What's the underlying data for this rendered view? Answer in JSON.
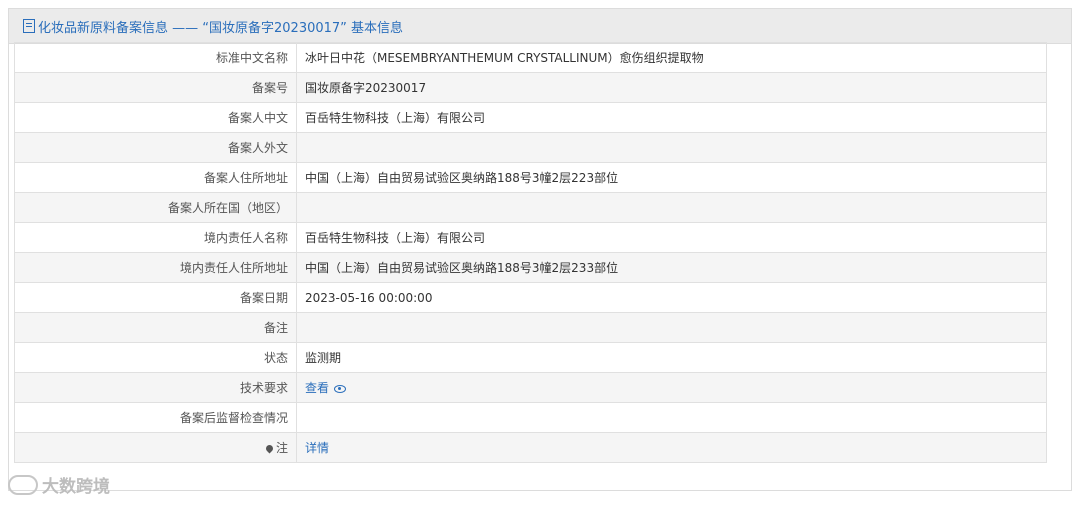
{
  "header": {
    "title": "化妆品新原料备案信息 —— “国妆原备字20230017” 基本信息"
  },
  "rows": [
    {
      "label": "标准中文名称",
      "value": "冰叶日中花（MESEMBRYANTHEMUM CRYSTALLINUM）愈伤组织提取物"
    },
    {
      "label": "备案号",
      "value": "国妆原备字20230017"
    },
    {
      "label": "备案人中文",
      "value": "百岳特生物科技（上海）有限公司"
    },
    {
      "label": "备案人外文",
      "value": ""
    },
    {
      "label": "备案人住所地址",
      "value": "中国（上海）自由贸易试验区奥纳路188号3幢2层223部位"
    },
    {
      "label": "备案人所在国（地区）",
      "value": ""
    },
    {
      "label": "境内责任人名称",
      "value": "百岳特生物科技（上海）有限公司"
    },
    {
      "label": "境内责任人住所地址",
      "value": "中国（上海）自由贸易试验区奥纳路188号3幢2层233部位"
    },
    {
      "label": "备案日期",
      "value": "2023-05-16 00:00:00"
    },
    {
      "label": "备注",
      "value": ""
    },
    {
      "label": "状态",
      "value": "监测期"
    },
    {
      "label": "技术要求",
      "value": "查看"
    },
    {
      "label": "备案后监督检查情况",
      "value": ""
    },
    {
      "label": "注",
      "value": "详情"
    }
  ],
  "watermark": {
    "text": "大数跨境"
  }
}
